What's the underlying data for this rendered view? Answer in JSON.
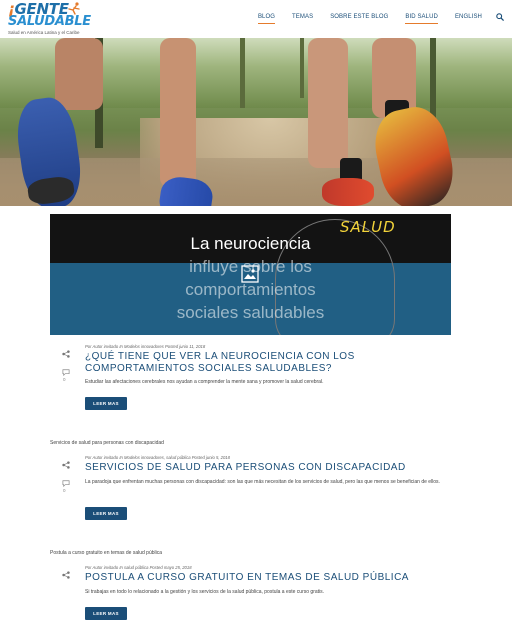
{
  "header": {
    "logo": {
      "line1_prefix": "GENTE",
      "line2": "SALUDABLE",
      "subtitle": "Salud en América Latina y el Caribe"
    },
    "nav": [
      {
        "label": "BLOG",
        "active": true
      },
      {
        "label": "TEMAS",
        "active": false
      },
      {
        "label": "SOBRE ESTE BLOG",
        "active": false
      },
      {
        "label": "BID SALUD",
        "active": false
      },
      {
        "label": "ENGLISH",
        "active": false
      }
    ],
    "search_icon": "search-icon"
  },
  "banner": {
    "salud_label": "SALUD",
    "lines": [
      "La neurociencia",
      "influye sobre los",
      "comportamientos",
      "sociales saludables"
    ]
  },
  "posts": [
    {
      "meta": {
        "by": "Por",
        "author": "Autor invitado",
        "in": "In",
        "category": "Modelos innovadores",
        "posted": "Posted",
        "date": "junio 11, 2018"
      },
      "title": "¿QUÉ TIENE QUE VER LA NEUROCIENCIA CON LOS COMPORTAMIENTOS SOCIALES SALUDABLES?",
      "excerpt": "Estudiar las afectaciones cerebrales nos ayudan a comprender la mente sana y promover la salud cerebral.",
      "button": "LEER MAS",
      "comments": "0"
    },
    {
      "image_alt": "Servicios de salud para personas con discapacidad",
      "meta": {
        "by": "Por",
        "author": "Autor invitado",
        "in": "In",
        "category": "Modelos innovadores, salud pública",
        "posted": "Posted",
        "date": "junio 5, 2018"
      },
      "title": "SERVICIOS DE SALUD PARA PERSONAS CON DISCAPACIDAD",
      "excerpt": "La paradoja que enfrentan muchas personas con discapacidad: son las que más necesitan de los servicios de salud, pero las que menos se benefician de ellos.",
      "button": "LEER MAS",
      "comments": "0"
    },
    {
      "image_alt": "Postula a curso gratuito en temas de salud pública",
      "meta": {
        "by": "Por",
        "author": "Autor invitado",
        "in": "In",
        "category": "salud pública",
        "posted": "Posted",
        "date": "mayo 25, 2018"
      },
      "title": "POSTULA A CURSO GRATUITO EN TEMAS DE SALUD PÚBLICA",
      "excerpt": "Si trabajas en todo lo relacionado a la gestión y los servicios de la salud pública, postula a este curso gratis.",
      "button": "LEER MAS"
    }
  ],
  "colors": {
    "brand_blue": "#1b4e78",
    "accent_orange": "#e57b2c",
    "banner_blue": "#215f84",
    "banner_yellow": "#f2d33a"
  }
}
